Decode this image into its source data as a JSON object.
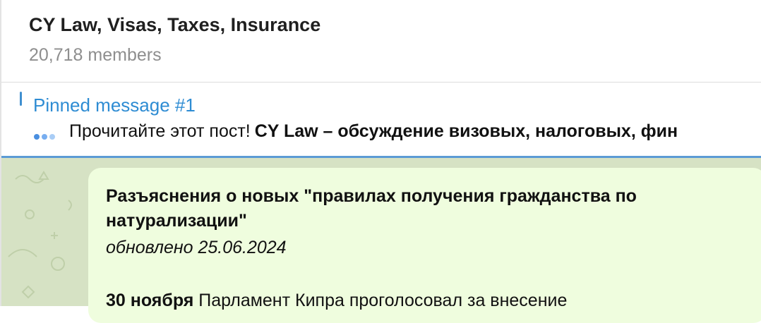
{
  "chat": {
    "title": "CY Law, Visas, Taxes, Insurance",
    "members": "20,718 members"
  },
  "pinned": {
    "label": "Pinned message #1",
    "preview_plain": "Прочитайте этот пост!",
    "preview_bold": "CY Law – обсуждение визовых, налоговых, фин"
  },
  "message": {
    "title": "Разъяснения о новых \"правилах получения гражданства по натурализации\"",
    "updated": "обновлено 25.06.2024",
    "body_bold": "30 ноября",
    "body_text": " Парламент Кипра проголосовал за внесение"
  },
  "colors": {
    "accent": "#2e8cd3",
    "bubble": "#effdde",
    "chat_bg": "#d6e2c4",
    "muted": "#8e8e8e"
  }
}
